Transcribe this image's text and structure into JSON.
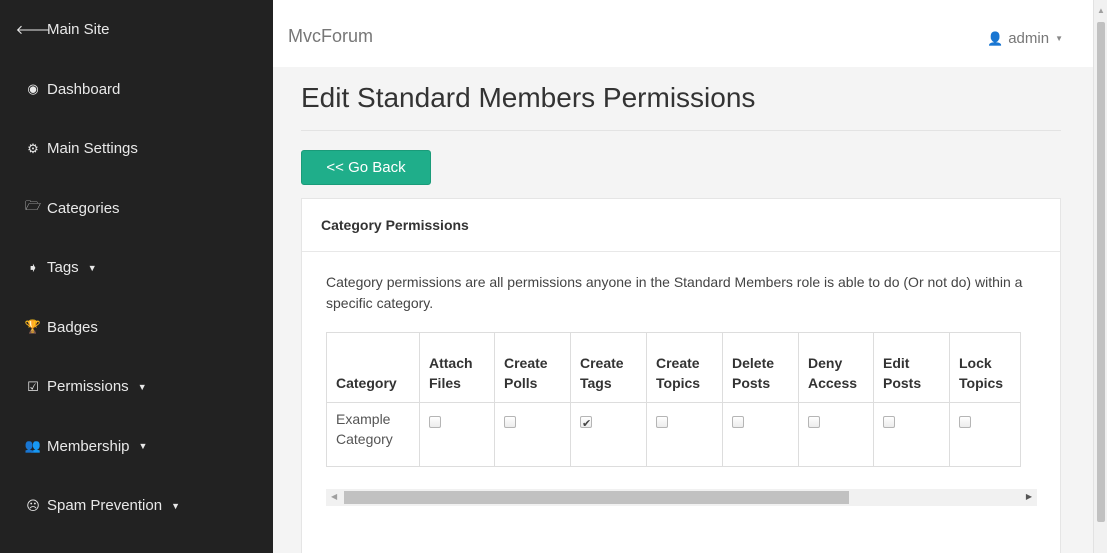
{
  "sidebar": {
    "items": [
      {
        "label": "Main Site",
        "icon": "arrow-left-icon",
        "glyph": "🡐",
        "caret": false
      },
      {
        "label": "Dashboard",
        "icon": "dashboard-icon",
        "glyph": "◉",
        "caret": false
      },
      {
        "label": "Main Settings",
        "icon": "cogs-icon",
        "glyph": "⚙",
        "caret": false
      },
      {
        "label": "Categories",
        "icon": "folder-open-icon",
        "glyph": "🗁",
        "caret": false
      },
      {
        "label": "Tags",
        "icon": "tags-icon",
        "glyph": "➧",
        "caret": true
      },
      {
        "label": "Badges",
        "icon": "trophy-icon",
        "glyph": "🏆",
        "caret": false
      },
      {
        "label": "Permissions",
        "icon": "check-square-icon",
        "glyph": "☑",
        "caret": true
      },
      {
        "label": "Membership",
        "icon": "users-icon",
        "glyph": "👥",
        "caret": true
      },
      {
        "label": "Spam Prevention",
        "icon": "frown-icon",
        "glyph": "☹",
        "caret": true
      }
    ],
    "caret_glyph": "▼"
  },
  "header": {
    "brand": "MvcForum",
    "user": "admin",
    "user_icon": "user-icon",
    "user_glyph": "👤",
    "caret_glyph": "▼"
  },
  "main": {
    "title": "Edit Standard Members Permissions",
    "back_button": "<< Go Back",
    "panel": {
      "heading": "Category Permissions",
      "description": "Category permissions are all permissions anyone in the Standard Members role is able to do (Or not do) within a specific category.",
      "table": {
        "headers": [
          "Category",
          "Attach Files",
          "Create Polls",
          "Create Tags",
          "Create Topics",
          "Delete Posts",
          "Deny Access",
          "Edit Posts",
          "Lock Topics"
        ],
        "rows": [
          {
            "category": "Example Category",
            "checked": [
              false,
              false,
              true,
              false,
              false,
              false,
              false,
              false
            ]
          }
        ]
      }
    }
  },
  "colors": {
    "sidebar_bg": "#222222",
    "accent_button": "#1fae8a"
  }
}
